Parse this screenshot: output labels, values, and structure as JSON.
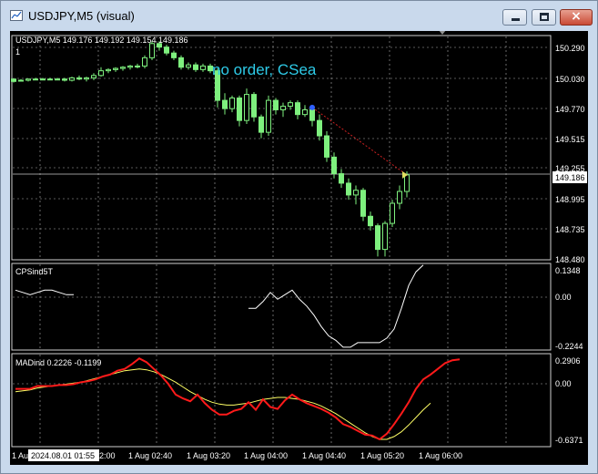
{
  "window": {
    "title": "USDJPY,M5 (visual)",
    "controls": {
      "minimize": "minimize",
      "maximize": "maximize",
      "close": "×"
    }
  },
  "main_panel": {
    "symbol_info": "USDJPY,M5  149.176 149.192 149.154 149.186",
    "sub_label": "1",
    "annotation": "no order, CSea",
    "annotation_color": "#2ecbe8",
    "bid_label": "149.186",
    "price_scale": [
      "150.290",
      "150.030",
      "149.770",
      "149.515",
      "149.255",
      "148.995",
      "148.735",
      "148.480"
    ]
  },
  "indicator1": {
    "label": "CPSind5T",
    "scale": [
      "0.1348",
      "0.00",
      "-0.2244"
    ]
  },
  "indicator2": {
    "label": "MADind 0.2226 -0.1199",
    "scale": [
      "0.2906",
      "0.00",
      "-0.6371"
    ]
  },
  "time_axis": {
    "labels": [
      "1 Au",
      "2:00",
      "1 Aug 02:40",
      "1 Aug 03:20",
      "1 Aug 04:00",
      "1 Aug 04:40",
      "1 Aug 05:20",
      "1 Aug 06:00"
    ],
    "cursor_label": "2024.08.01 01:55"
  },
  "colors": {
    "background": "#000000",
    "bull": "#7ef07e",
    "grid": "#b0b0b0",
    "line_white": "#ffffff",
    "line_red": "#ff1a1a",
    "line_yellow": "#ffff66",
    "trade_dotted": "#cc2020"
  },
  "chart_data": [
    {
      "type": "candlestick",
      "name": "USDJPY,M5",
      "ylim": [
        148.48,
        150.36
      ],
      "candles": [
        [
          150.0,
          150.0,
          149.97,
          149.98
        ],
        [
          149.99,
          150.0,
          149.98,
          149.99
        ],
        [
          149.99,
          150.0,
          149.98,
          150.0
        ],
        [
          150.0,
          150.01,
          149.99,
          150.0
        ],
        [
          150.0,
          150.01,
          149.99,
          150.0
        ],
        [
          150.0,
          150.01,
          149.99,
          150.0
        ],
        [
          150.0,
          150.01,
          149.99,
          150.0
        ],
        [
          150.0,
          150.01,
          149.98,
          149.99
        ],
        [
          149.99,
          150.02,
          149.98,
          150.01
        ],
        [
          150.01,
          150.03,
          149.99,
          150.0
        ],
        [
          150.0,
          150.02,
          149.98,
          150.01
        ],
        [
          150.01,
          150.05,
          149.99,
          150.03
        ],
        [
          150.03,
          150.1,
          150.02,
          150.07
        ],
        [
          150.07,
          150.09,
          150.05,
          150.08
        ],
        [
          150.08,
          150.1,
          150.06,
          150.09
        ],
        [
          150.09,
          150.11,
          150.07,
          150.1
        ],
        [
          150.1,
          150.12,
          150.08,
          150.11
        ],
        [
          150.11,
          150.13,
          150.09,
          150.11
        ],
        [
          150.11,
          150.2,
          150.09,
          150.18
        ],
        [
          150.18,
          150.32,
          150.16,
          150.3
        ],
        [
          150.3,
          150.32,
          150.24,
          150.27
        ],
        [
          150.27,
          150.29,
          150.2,
          150.22
        ],
        [
          150.22,
          150.24,
          150.16,
          150.18
        ],
        [
          150.18,
          150.2,
          150.08,
          150.1
        ],
        [
          150.1,
          150.14,
          150.08,
          150.12
        ],
        [
          150.12,
          150.14,
          150.06,
          150.08
        ],
        [
          150.08,
          150.13,
          150.06,
          150.11
        ],
        [
          150.11,
          150.13,
          150.05,
          150.07
        ],
        [
          150.07,
          150.09,
          149.76,
          149.82
        ],
        [
          149.82,
          149.88,
          149.7,
          149.75
        ],
        [
          149.75,
          149.86,
          149.72,
          149.84
        ],
        [
          149.84,
          149.86,
          149.6,
          149.65
        ],
        [
          149.65,
          149.92,
          149.62,
          149.87
        ],
        [
          149.87,
          149.89,
          149.64,
          149.68
        ],
        [
          149.68,
          149.7,
          149.5,
          149.55
        ],
        [
          149.55,
          149.86,
          149.52,
          149.82
        ],
        [
          149.82,
          149.84,
          149.7,
          149.74
        ],
        [
          149.74,
          149.8,
          149.68,
          149.77
        ],
        [
          149.77,
          149.82,
          149.74,
          149.8
        ],
        [
          149.8,
          149.82,
          149.66,
          149.7
        ],
        [
          149.7,
          149.78,
          149.68,
          149.74
        ],
        [
          149.74,
          149.76,
          149.6,
          149.65
        ],
        [
          149.65,
          149.7,
          149.48,
          149.52
        ],
        [
          149.52,
          149.56,
          149.3,
          149.34
        ],
        [
          149.34,
          149.38,
          149.16,
          149.2
        ],
        [
          149.2,
          149.24,
          149.08,
          149.12
        ],
        [
          149.12,
          149.16,
          148.98,
          149.02
        ],
        [
          149.02,
          149.1,
          148.94,
          149.06
        ],
        [
          149.06,
          149.08,
          148.8,
          148.84
        ],
        [
          148.84,
          148.88,
          148.72,
          148.76
        ],
        [
          148.76,
          148.78,
          148.5,
          148.56
        ],
        [
          148.56,
          148.8,
          148.5,
          148.78
        ],
        [
          148.78,
          148.98,
          148.75,
          148.95
        ],
        [
          148.95,
          149.1,
          148.9,
          149.05
        ],
        [
          149.05,
          149.22,
          149.0,
          149.19
        ]
      ],
      "trade_marker": {
        "from": [
          41,
          149.76
        ],
        "to": [
          54,
          149.19
        ]
      }
    },
    {
      "type": "line",
      "name": "CPSind5T",
      "ylim": [
        -0.2244,
        0.1348
      ],
      "series": [
        {
          "name": "",
          "values": [
            0.03,
            0.02,
            0.01,
            0.02,
            0.03,
            0.03,
            0.02,
            0.01,
            0.01,
            null,
            null,
            null,
            null,
            null,
            null,
            null,
            null,
            null,
            null,
            null,
            null,
            null,
            null,
            null,
            null,
            null,
            null,
            null,
            null,
            null,
            null,
            null,
            -0.05,
            -0.05,
            -0.02,
            0.02,
            -0.01,
            0.01,
            0.03,
            -0.01,
            -0.04,
            -0.08,
            -0.13,
            -0.17,
            -0.19,
            -0.22,
            -0.22,
            -0.2,
            -0.2,
            -0.2,
            -0.2,
            -0.18,
            -0.14,
            -0.05,
            0.05,
            0.11,
            0.14
          ]
        }
      ]
    },
    {
      "type": "line",
      "name": "MADind",
      "ylim": [
        -0.6371,
        0.2906
      ],
      "series": [
        {
          "name": "",
          "color": "#ff1a1a",
          "values": [
            -0.05,
            -0.05,
            -0.05,
            -0.02,
            -0.02,
            -0.02,
            -0.01,
            -0.01,
            0.0,
            0.02,
            0.03,
            0.05,
            0.08,
            0.1,
            0.14,
            0.16,
            0.21,
            0.27,
            0.23,
            0.16,
            0.09,
            0.0,
            -0.11,
            -0.15,
            -0.18,
            -0.11,
            -0.2,
            -0.27,
            -0.32,
            -0.32,
            -0.28,
            -0.26,
            -0.19,
            -0.27,
            -0.16,
            -0.24,
            -0.26,
            -0.17,
            -0.11,
            -0.16,
            -0.2,
            -0.23,
            -0.26,
            -0.3,
            -0.35,
            -0.42,
            -0.45,
            -0.49,
            -0.53,
            -0.54,
            -0.58,
            -0.52,
            -0.42,
            -0.31,
            -0.19,
            -0.05,
            0.05,
            0.1,
            0.16,
            0.22,
            0.25,
            0.26
          ]
        },
        {
          "name": "",
          "color": "#ffff66",
          "values": [
            -0.08,
            -0.07,
            -0.06,
            -0.04,
            -0.03,
            -0.02,
            -0.01,
            0.0,
            0.01,
            0.02,
            0.04,
            0.06,
            0.08,
            0.1,
            0.12,
            0.14,
            0.15,
            0.16,
            0.15,
            0.13,
            0.1,
            0.06,
            0.02,
            -0.03,
            -0.08,
            -0.12,
            -0.16,
            -0.19,
            -0.21,
            -0.22,
            -0.22,
            -0.21,
            -0.2,
            -0.18,
            -0.16,
            -0.15,
            -0.14,
            -0.14,
            -0.15,
            -0.16,
            -0.18,
            -0.2,
            -0.23,
            -0.27,
            -0.31,
            -0.36,
            -0.41,
            -0.46,
            -0.51,
            -0.55,
            -0.58,
            -0.58,
            -0.55,
            -0.5,
            -0.43,
            -0.35,
            -0.27,
            -0.2
          ]
        }
      ]
    }
  ]
}
